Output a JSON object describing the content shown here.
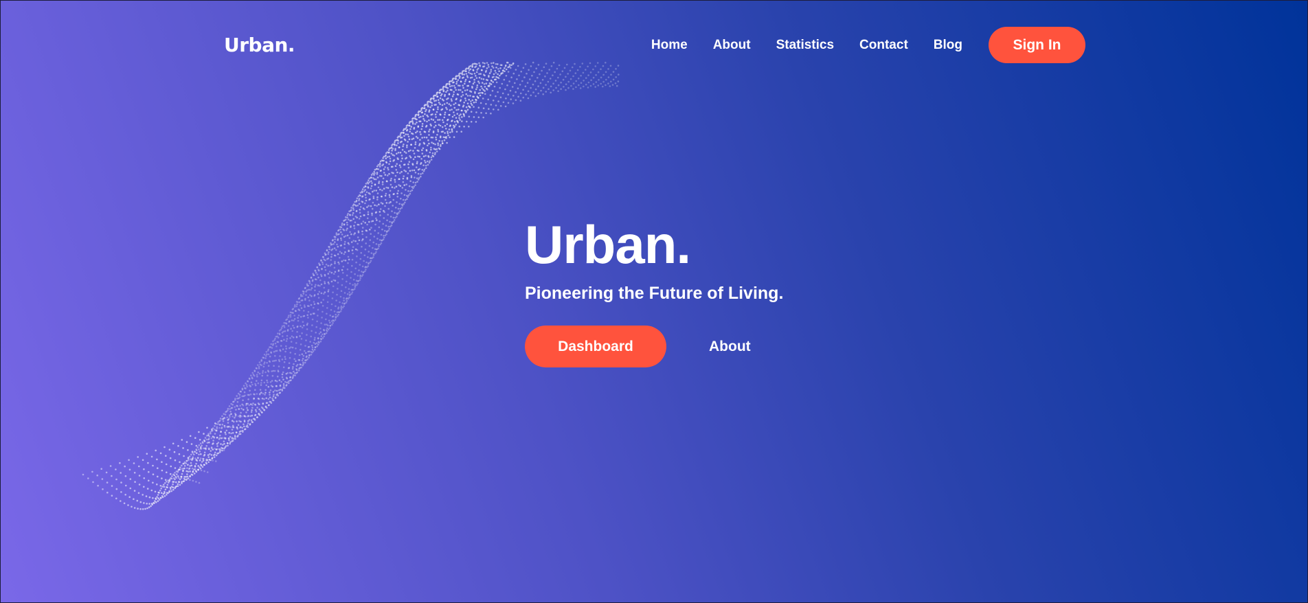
{
  "brand": {
    "logo": "Urban."
  },
  "nav": {
    "items": [
      {
        "label": "Home"
      },
      {
        "label": "About"
      },
      {
        "label": "Statistics"
      },
      {
        "label": "Contact"
      },
      {
        "label": "Blog"
      }
    ],
    "signin_label": "Sign In"
  },
  "hero": {
    "title": "Urban.",
    "subtitle": "Pioneering the Future of Living.",
    "primary_label": "Dashboard",
    "secondary_label": "About"
  },
  "colors": {
    "accent": "#ff533d",
    "gradient_start": "#7a68e8",
    "gradient_end": "#00339a",
    "text": "#ffffff"
  }
}
